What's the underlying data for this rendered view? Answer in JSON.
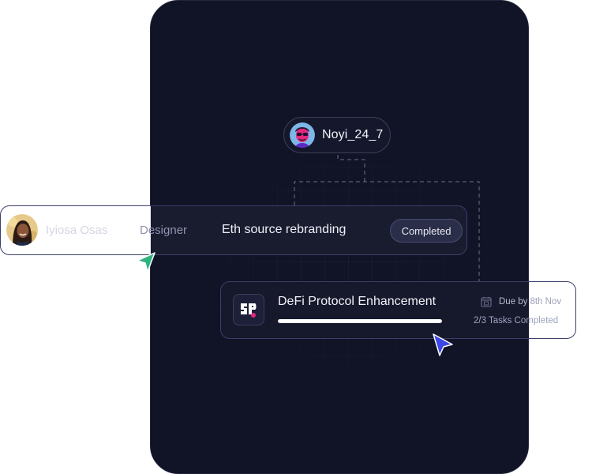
{
  "user_pill": {
    "username": "Noyi_24_7",
    "avatar": "cartoon-avatar-icon"
  },
  "member_row": {
    "name": "Iyiosa Osas",
    "role": "Designer",
    "project": "Eth source rebranding",
    "status": "Completed",
    "avatar": "person-photo-avatar"
  },
  "task": {
    "title": "DeFi Protocol Enhancement",
    "due_label": "Due by",
    "due_date": "8th Nov",
    "tasks_completed": "2/3 Tasks Completed",
    "progress": 1.0,
    "logo": "sp-logo-icon"
  },
  "colors": {
    "panel_bg": "#111326",
    "accent_green": "#2fb37e",
    "accent_blue": "#3d47e6",
    "card_border": "#3c3f6b"
  },
  "icons": {
    "calendar": "calendar-icon",
    "cursor_green": "green-pointer-cursor-icon",
    "cursor_blue": "blue-pointer-cursor-icon"
  }
}
